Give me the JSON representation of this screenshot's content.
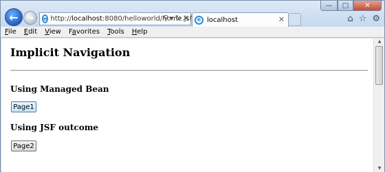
{
  "browser": {
    "url_prefix": "http://",
    "url_host": "localhost",
    "url_rest": ":8080/helloworld/home.jsf",
    "tab_title": "localhost"
  },
  "menu": [
    {
      "label": "File",
      "key": "F"
    },
    {
      "label": "Edit",
      "key": "E"
    },
    {
      "label": "View",
      "key": "V"
    },
    {
      "label": "Favorites",
      "key": "a"
    },
    {
      "label": "Tools",
      "key": "T"
    },
    {
      "label": "Help",
      "key": "H"
    }
  ],
  "page": {
    "title": "Implicit Navigation",
    "section1": "Using Managed Bean",
    "button1": "Page1",
    "section2": "Using JSF outcome",
    "button2": "Page2"
  },
  "icons": {
    "back": "back-arrow-icon",
    "forward": "forward-arrow-icon",
    "ie": "ie-logo-icon",
    "search": "search-icon",
    "refresh": "refresh-icon",
    "stop": "close-icon",
    "home": "home-icon",
    "favorites": "star-icon",
    "tools": "gear-icon"
  },
  "colors": {
    "accent": "#1f5fc0",
    "frame": "#c9dcf0"
  }
}
